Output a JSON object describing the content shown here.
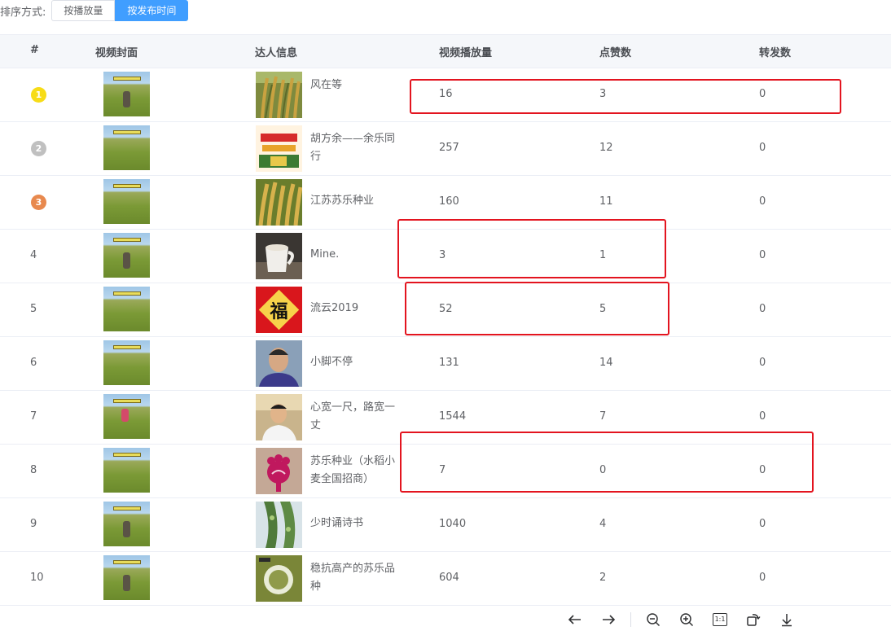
{
  "sort": {
    "label": "排序方式:",
    "buttons": [
      {
        "label": "按播放量",
        "active": false
      },
      {
        "label": "按发布时间",
        "active": true
      }
    ]
  },
  "table": {
    "headers": {
      "idx": "#",
      "cover": "视频封面",
      "creator": "达人信息",
      "plays": "视频播放量",
      "likes": "点赞数",
      "shares": "转发数"
    },
    "rows": [
      {
        "rank": "1",
        "name": "风在等",
        "plays": "16",
        "likes": "3",
        "shares": "0"
      },
      {
        "rank": "2",
        "name": "胡方余——余乐同行",
        "plays": "257",
        "likes": "12",
        "shares": "0"
      },
      {
        "rank": "3",
        "name": "江苏苏乐种业",
        "plays": "160",
        "likes": "11",
        "shares": "0"
      },
      {
        "rank": "4",
        "name": "Mine.",
        "plays": "3",
        "likes": "1",
        "shares": "0"
      },
      {
        "rank": "5",
        "name": "流云2019",
        "plays": "52",
        "likes": "5",
        "shares": "0"
      },
      {
        "rank": "6",
        "name": "小脚不停",
        "plays": "131",
        "likes": "14",
        "shares": "0"
      },
      {
        "rank": "7",
        "name": "心宽一尺，路宽一丈",
        "plays": "1544",
        "likes": "7",
        "shares": "0"
      },
      {
        "rank": "8",
        "name": "苏乐种业（水稻小麦全国招商）",
        "plays": "7",
        "likes": "0",
        "shares": "0"
      },
      {
        "rank": "9",
        "name": "少时诵诗书",
        "plays": "1040",
        "likes": "4",
        "shares": "0"
      },
      {
        "rank": "10",
        "name": "稳抗高产的苏乐品种",
        "plays": "604",
        "likes": "2",
        "shares": "0"
      }
    ],
    "avatar_5_glyph": "福"
  },
  "rank_colors": {
    "gold": "#f7dc17",
    "silver": "#c0c0c0",
    "bronze": "#e8894e"
  },
  "highlight_color": "#e3141f",
  "viewer_tools": [
    {
      "icon": "arrow-left-icon"
    },
    {
      "icon": "arrow-right-icon"
    },
    {
      "icon": "zoom-out-icon"
    },
    {
      "icon": "zoom-in-icon"
    },
    {
      "icon": "actual-size-icon",
      "glyph": "1:1"
    },
    {
      "icon": "rotate-icon"
    },
    {
      "icon": "download-icon"
    }
  ]
}
